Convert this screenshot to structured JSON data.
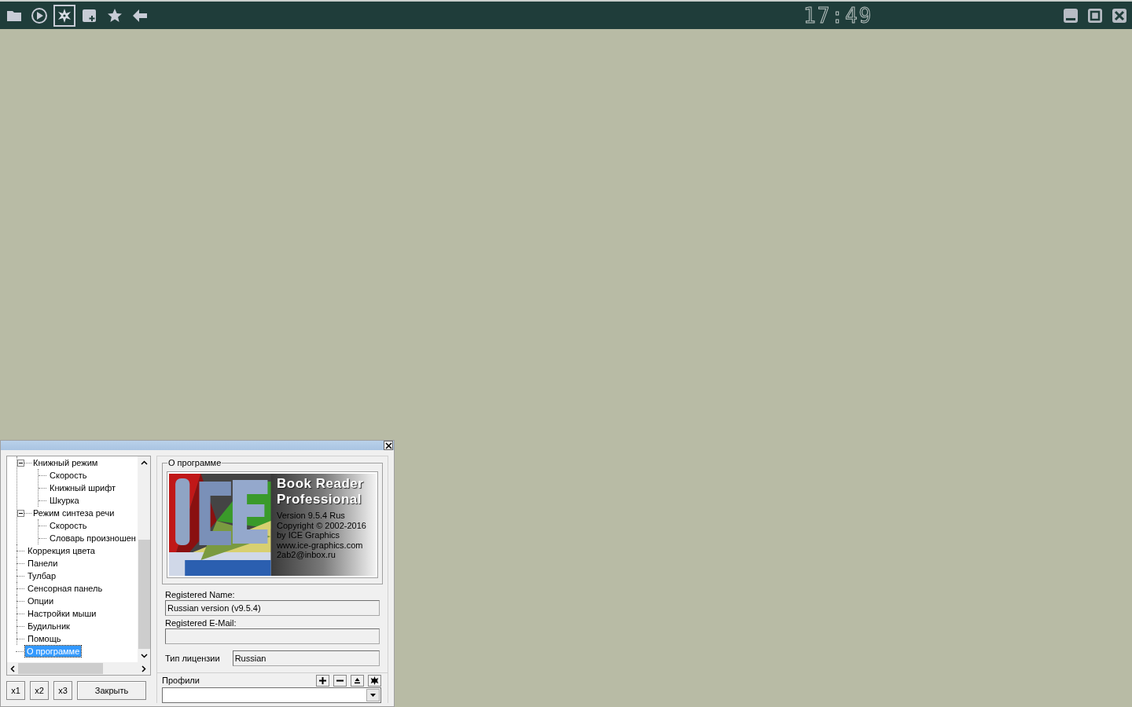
{
  "toolbar": {
    "items": [
      {
        "kind": "folder",
        "selected": false
      },
      {
        "kind": "play",
        "selected": false
      },
      {
        "kind": "gear",
        "selected": true
      },
      {
        "kind": "add-image",
        "selected": false
      },
      {
        "kind": "star",
        "selected": false
      },
      {
        "kind": "back",
        "selected": false
      }
    ]
  },
  "clock": "17:49",
  "dialog": {
    "tree": {
      "continued_children": [
        {
          "label": "Книжный режим",
          "expanded": true,
          "selected": false,
          "children": [
            {
              "label": "Скорость",
              "selected": false
            },
            {
              "label": "Книжный шрифт",
              "selected": false
            },
            {
              "label": "Шкурка",
              "selected": false
            }
          ]
        },
        {
          "label": "Режим синтеза речи",
          "expanded": true,
          "selected": false,
          "children": [
            {
              "label": "Скорость",
              "selected": false
            },
            {
              "label": "Словарь произношен",
              "selected": false
            }
          ]
        }
      ],
      "items": [
        {
          "label": "Коррекция цвета",
          "selected": false
        },
        {
          "label": "Панели",
          "selected": false
        },
        {
          "label": "Тулбар",
          "selected": false
        },
        {
          "label": "Сенсорная панель",
          "selected": false
        },
        {
          "label": "Опции",
          "selected": false
        },
        {
          "label": "Настройки мыши",
          "selected": false
        },
        {
          "label": "Будильник",
          "selected": false
        },
        {
          "label": "Помощь",
          "selected": false
        },
        {
          "label": "О программе",
          "selected": true
        }
      ]
    },
    "buttons": [
      "x1",
      "x2",
      "x3",
      "Закрыть"
    ],
    "group_title": "О программе",
    "splash": {
      "title_lines": [
        "Book Reader",
        "Professional"
      ],
      "info_lines": [
        "Version 9.5.4 Rus",
        "Copyright © 2002-2016",
        "by ICE Graphics",
        "www.ice-graphics.com",
        "2ab2@inbox.ru"
      ]
    },
    "registered_name": {
      "label": "Registered Name:",
      "value": "Russian version (v9.5.4)"
    },
    "registered_email": {
      "label": "Registered E-Mail:"
    },
    "license": {
      "label": "Тип лицензии",
      "value": "Russian"
    },
    "profiles": {
      "label": "Профили",
      "actions": [
        {
          "kind": "add"
        },
        {
          "kind": "remove"
        },
        {
          "kind": "eject"
        },
        {
          "kind": "settings"
        }
      ]
    }
  }
}
